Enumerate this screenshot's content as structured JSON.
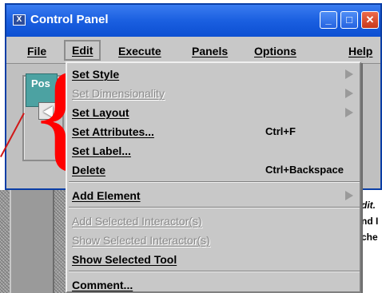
{
  "window": {
    "title": "Control Panel",
    "title_icon": "X"
  },
  "titlebar_buttons": [
    {
      "name": "minimize",
      "glyph": "_"
    },
    {
      "name": "maximize",
      "glyph": "□"
    },
    {
      "name": "close",
      "glyph": "✕"
    }
  ],
  "menubar": [
    {
      "label": "File"
    },
    {
      "label": "Edit"
    },
    {
      "label": "Execute"
    },
    {
      "label": "Panels"
    },
    {
      "label": "Options"
    },
    {
      "label": "Help"
    }
  ],
  "client": {
    "tab_label": "Pos"
  },
  "dropdown": {
    "items": [
      {
        "label": "Set Style",
        "accel": "",
        "submenu": true,
        "disabled": false
      },
      {
        "label": "Set Dimensionality",
        "accel": "",
        "submenu": true,
        "disabled": true
      },
      {
        "label": "Set Layout",
        "accel": "",
        "submenu": true,
        "disabled": false
      },
      {
        "label": "Set Attributes...",
        "accel": "Ctrl+F",
        "submenu": false,
        "disabled": false
      },
      {
        "label": "Set Label...",
        "accel": "",
        "submenu": false,
        "disabled": false
      },
      {
        "label": "Delete",
        "accel": "Ctrl+Backspace",
        "submenu": false,
        "disabled": false
      },
      {
        "label": "Add Element",
        "accel": "",
        "submenu": true,
        "disabled": false
      },
      {
        "label": "Add Selected Interactor(s)",
        "accel": "",
        "submenu": false,
        "disabled": true
      },
      {
        "label": "Show Selected Interactor(s)",
        "accel": "",
        "submenu": false,
        "disabled": true
      },
      {
        "label": "Show Selected Tool",
        "accel": "",
        "submenu": false,
        "disabled": false
      },
      {
        "label": "Comment...",
        "accel": "",
        "submenu": false,
        "disabled": false
      }
    ]
  },
  "background_text": [
    "dit.",
    "nd I",
    "che"
  ],
  "colors": {
    "annotation": "#ff0000",
    "title_bar": "#1a5fe0"
  }
}
